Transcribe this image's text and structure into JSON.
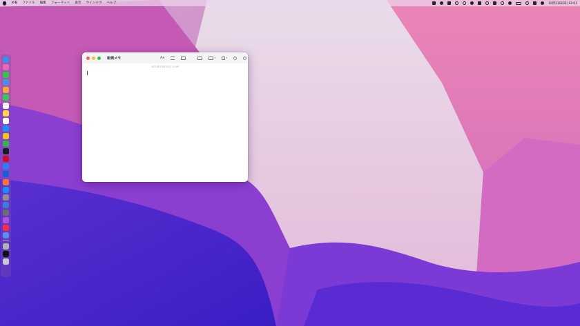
{
  "menubar": {
    "app_name": "メモ",
    "items": [
      "ファイル",
      "編集",
      "フォーマット",
      "表示",
      "ウインドウ",
      "ヘルプ"
    ],
    "clock": "10月31日(日) 12:01",
    "status_icons": [
      "screen-mirroring-icon",
      "music-icon",
      "dropbox-icon",
      "sync-icon",
      "gear-icon",
      "cloud-icon",
      "input-method-icon",
      "radio-icon",
      "bluetooth-icon",
      "wifi-icon",
      "volume-icon",
      "battery-icon",
      "search-icon",
      "control-center-icon",
      "siri-icon"
    ]
  },
  "window": {
    "title": "新規メモ",
    "date": "2021年10月31日 12:00",
    "toolbar": {
      "format_label": "Aa",
      "icons": [
        "checklist-icon",
        "table-icon",
        "media-icon",
        "share-icon",
        "lock-icon",
        "collaborate-icon",
        "search-icon"
      ]
    }
  },
  "dock": {
    "icons": [
      {
        "name": "finder-icon",
        "color": "#3d8ee8"
      },
      {
        "name": "launchpad-icon",
        "color": "#e86ab2"
      },
      {
        "name": "messages-icon",
        "color": "#33c748"
      },
      {
        "name": "mail-icon",
        "color": "#4a90e2"
      },
      {
        "name": "photos-icon",
        "color": "#f2a93b"
      },
      {
        "name": "facetime-icon",
        "color": "#34c759"
      },
      {
        "name": "calendar-icon",
        "color": "#f4f4f4"
      },
      {
        "name": "notes-icon",
        "color": "#ffd54a"
      },
      {
        "name": "reminders-icon",
        "color": "#fafafa"
      },
      {
        "name": "safari-icon",
        "color": "#1e90ff"
      },
      {
        "name": "chrome-icon",
        "color": "#f0c419"
      },
      {
        "name": "numbers-icon",
        "color": "#36b24a"
      },
      {
        "name": "clock-icon",
        "color": "#1c1c1e"
      },
      {
        "name": "app-icon",
        "color": "#c8102e"
      },
      {
        "name": "pages-icon",
        "color": "#2f7df6"
      },
      {
        "name": "bitwarden-icon",
        "color": "#175ddc"
      },
      {
        "name": "firefox-icon",
        "color": "#ff7139"
      },
      {
        "name": "app-store-icon",
        "color": "#1a8cff"
      },
      {
        "name": "settings-icon",
        "color": "#8e8e93"
      },
      {
        "name": "keynote-icon",
        "color": "#3f7bd9"
      },
      {
        "name": "system-preferences-icon",
        "color": "#6e6e73"
      },
      {
        "name": "podcasts-icon",
        "color": "#b150e2"
      },
      {
        "name": "music-icon",
        "color": "#fa2d48"
      },
      {
        "name": "downloads-icon",
        "color": "#5b8cf0"
      },
      {
        "name": "disk-utility-icon",
        "color": "#b0b0b5"
      },
      {
        "name": "apple-tv-icon",
        "color": "#111111"
      },
      {
        "name": "trash-icon",
        "color": "#c9c9d6"
      }
    ]
  }
}
